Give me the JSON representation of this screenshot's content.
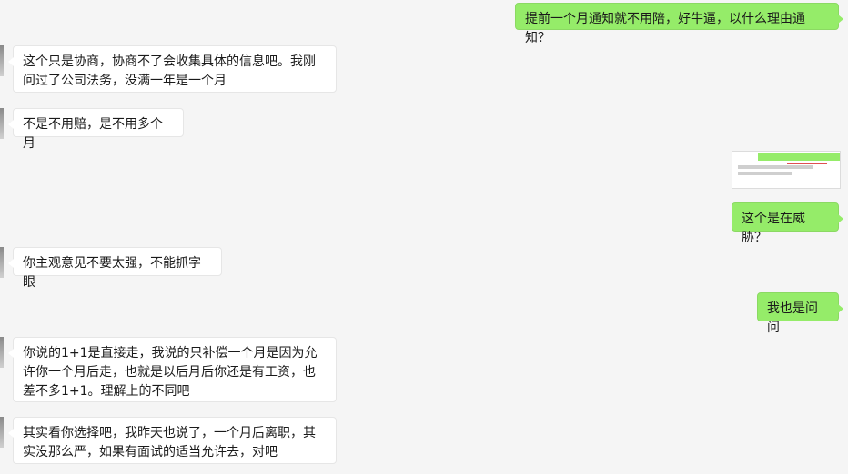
{
  "messages": [
    {
      "side": "out",
      "text": "提前一个月通知就不用陪，好牛逼，以什么理由通知？"
    },
    {
      "side": "in",
      "text": "这个只是协商，协商不了会收集具体的信息吧。我刚问过了公司法务，没满一年是一个月"
    },
    {
      "side": "in",
      "text": "不是不用赔，是不用多个月"
    },
    {
      "side": "out",
      "type": "image",
      "alt": "screenshot-thumbnail"
    },
    {
      "side": "out",
      "text": "这个是在威胁？"
    },
    {
      "side": "in",
      "text": "你主观意见不要太强，不能抓字眼"
    },
    {
      "side": "out",
      "text": "我也是问问"
    },
    {
      "side": "in",
      "text": "你说的1+1是直接走，我说的只补偿一个月是因为允许你一个月后走，也就是以后月后你还是有工资，也差不多1+1。理解上的不同吧"
    },
    {
      "side": "in",
      "text": "其实看你选择吧，我昨天也说了，一个月后离职，其实没那么严，如果有面试的适当允许去，对吧"
    }
  ],
  "colors": {
    "background": "#f5f5f5",
    "outgoing_bubble": "#95ec69",
    "incoming_bubble": "#ffffff"
  }
}
